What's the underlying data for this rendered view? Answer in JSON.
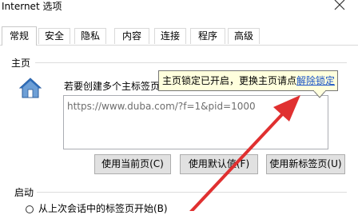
{
  "window": {
    "title": "Internet 选项"
  },
  "tabs": [
    {
      "label": "常规",
      "active": true
    },
    {
      "label": "安全"
    },
    {
      "label": "隐私"
    },
    {
      "label": "内容"
    },
    {
      "label": "连接"
    },
    {
      "label": "程序"
    },
    {
      "label": "高级"
    }
  ],
  "homepage": {
    "section_label": "主页",
    "description": "若要创建多个主标签页",
    "url_value": "https://www.duba.com/?f=1&pid=1000",
    "buttons": {
      "use_current": "使用当前页(C)",
      "use_default": "使用默认值(F)",
      "use_new_tab": "使用新标签页(U)"
    }
  },
  "tooltip": {
    "text": "主页锁定已开启，更换主页请点",
    "link": "解除锁定"
  },
  "startup": {
    "section_label": "启动",
    "option_text": "从上次会话中的标签页开始(B)"
  },
  "colors": {
    "tooltip_bg": "#ffffdd",
    "link": "#1a53c6",
    "annotation_arrow": "#e03030"
  }
}
